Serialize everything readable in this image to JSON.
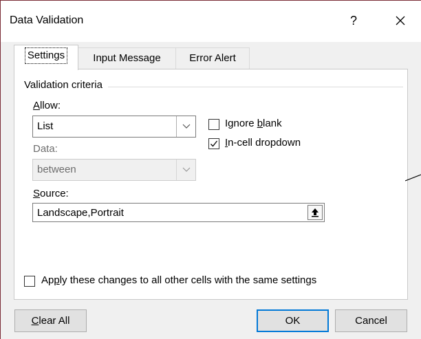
{
  "window": {
    "title": "Data Validation",
    "help": "?",
    "close_icon": "close-x-icon"
  },
  "tabs": [
    {
      "label": "Settings",
      "active": true
    },
    {
      "label": "Input Message",
      "active": false
    },
    {
      "label": "Error Alert",
      "active": false
    }
  ],
  "criteria": {
    "group_label": "Validation criteria",
    "allow_label_pre": "",
    "allow_label_key": "A",
    "allow_label_post": "llow:",
    "allow_value": "List",
    "data_label": "Data:",
    "data_value": "between",
    "ignore_blank": {
      "pre": "Ignore ",
      "key": "b",
      "post": "lank",
      "checked": false
    },
    "in_cell_dropdown": {
      "pre": "",
      "key": "I",
      "post": "n-cell dropdown",
      "checked": true
    },
    "source_label_key": "S",
    "source_label_post": "ource:",
    "source_value": "Landscape,Portrait",
    "source_button_icon": "collapse-dialog-arrow-icon"
  },
  "apply_all": {
    "pre": "Ap",
    "key": "p",
    "post": "ly these changes to all other cells with the same settings",
    "checked": false
  },
  "buttons": {
    "clear_all_key": "C",
    "clear_all_post": "lear All",
    "ok": "OK",
    "cancel": "Cancel"
  }
}
